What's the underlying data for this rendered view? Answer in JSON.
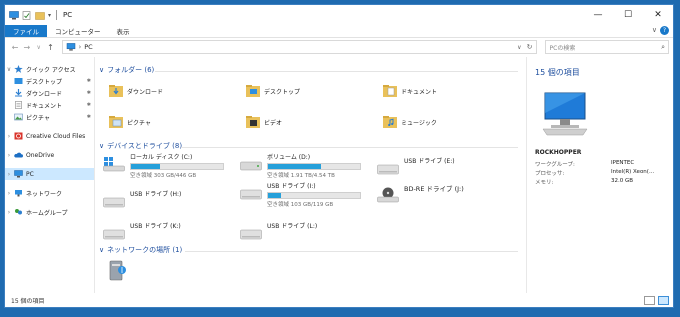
{
  "window": {
    "title": "PC",
    "menu_glyph": "▾",
    "controls": {
      "minimize": "—",
      "maximize": "☐",
      "close": "✕"
    }
  },
  "ribbon": {
    "tabs": [
      {
        "label": "ファイル",
        "active": true
      },
      {
        "label": "コンピューター",
        "active": false
      },
      {
        "label": "表示",
        "active": false
      }
    ],
    "expand_glyph": "∨",
    "help_glyph": "?"
  },
  "address": {
    "back": "←",
    "forward": "→",
    "recent": "∨",
    "up": "↑",
    "path": "PC",
    "path_sep": "›",
    "dropdown": "∨",
    "refresh": "↻",
    "search_placeholder": "PCの検索",
    "search_icon": "⌕"
  },
  "nav": {
    "quick_access": "クイック アクセス",
    "items": [
      {
        "label": "デスクトップ",
        "icon": "desktop-icon"
      },
      {
        "label": "ダウンロード",
        "icon": "download-icon"
      },
      {
        "label": "ドキュメント",
        "icon": "document-icon"
      },
      {
        "label": "ピクチャ",
        "icon": "picture-icon"
      }
    ],
    "creative_cloud": "Creative Cloud Files",
    "onedrive": "OneDrive",
    "pc": "PC",
    "network": "ネットワーク",
    "homegroup": "ホームグループ",
    "pin_glyph": "✱",
    "expand_glyph": "›",
    "collapse_glyph": "∨"
  },
  "groups": {
    "folders": "フォルダー (6)",
    "devices": "デバイスとドライブ (8)",
    "network_locations": "ネットワークの場所 (1)",
    "chev": "∨"
  },
  "folders": [
    {
      "label": "ダウンロード",
      "icon": "download-folder-icon"
    },
    {
      "label": "デスクトップ",
      "icon": "desktop-folder-icon"
    },
    {
      "label": "ドキュメント",
      "icon": "documents-folder-icon"
    },
    {
      "label": "ピクチャ",
      "icon": "pictures-folder-icon"
    },
    {
      "label": "ビデオ",
      "icon": "videos-folder-icon"
    },
    {
      "label": "ミュージック",
      "icon": "music-folder-icon"
    }
  ],
  "drives": [
    {
      "name": "ローカル ディスク (C:)",
      "free": "空き領域 303 GB/446 GB",
      "used_fraction": 0.32,
      "icon": "windows-drive-icon"
    },
    {
      "name": "ボリューム (D:)",
      "free": "空き領域 1.91 TB/4.54 TB",
      "used_fraction": 0.58,
      "icon": "hard-drive-icon"
    },
    {
      "name": "USB ドライブ (E:)",
      "free": "",
      "icon": "usb-drive-icon"
    },
    {
      "name": "USB ドライブ (H:)",
      "free": "",
      "icon": "usb-drive-icon"
    },
    {
      "name": "USB ドライブ (I:)",
      "free": "空き領域 103 GB/119 GB",
      "used_fraction": 0.14,
      "icon": "usb-drive-icon"
    },
    {
      "name": "BD-RE ドライブ (J:)",
      "free": "",
      "icon": "bd-drive-icon"
    },
    {
      "name": "USB ドライブ (K:)",
      "free": "",
      "icon": "usb-drive-icon"
    },
    {
      "name": "USB ドライブ (L:)",
      "free": "",
      "icon": "usb-drive-icon"
    }
  ],
  "details": {
    "title": "15 個の項目",
    "name": "ROCKHOPPER",
    "rows": [
      {
        "key": "ワークグループ:",
        "value": "IPENTEC"
      },
      {
        "key": "プロセッサ:",
        "value": "Intel(R) Xeon(..."
      },
      {
        "key": "メモリ:",
        "value": "32.0 GB"
      }
    ]
  },
  "status": {
    "count": "15 個の項目"
  },
  "colors": {
    "accent": "#1979ca",
    "desktop": "#1f6bb0",
    "group_header": "#1e4e9e",
    "bar_fill": "#26a0da",
    "folder": "#e9c15a"
  }
}
